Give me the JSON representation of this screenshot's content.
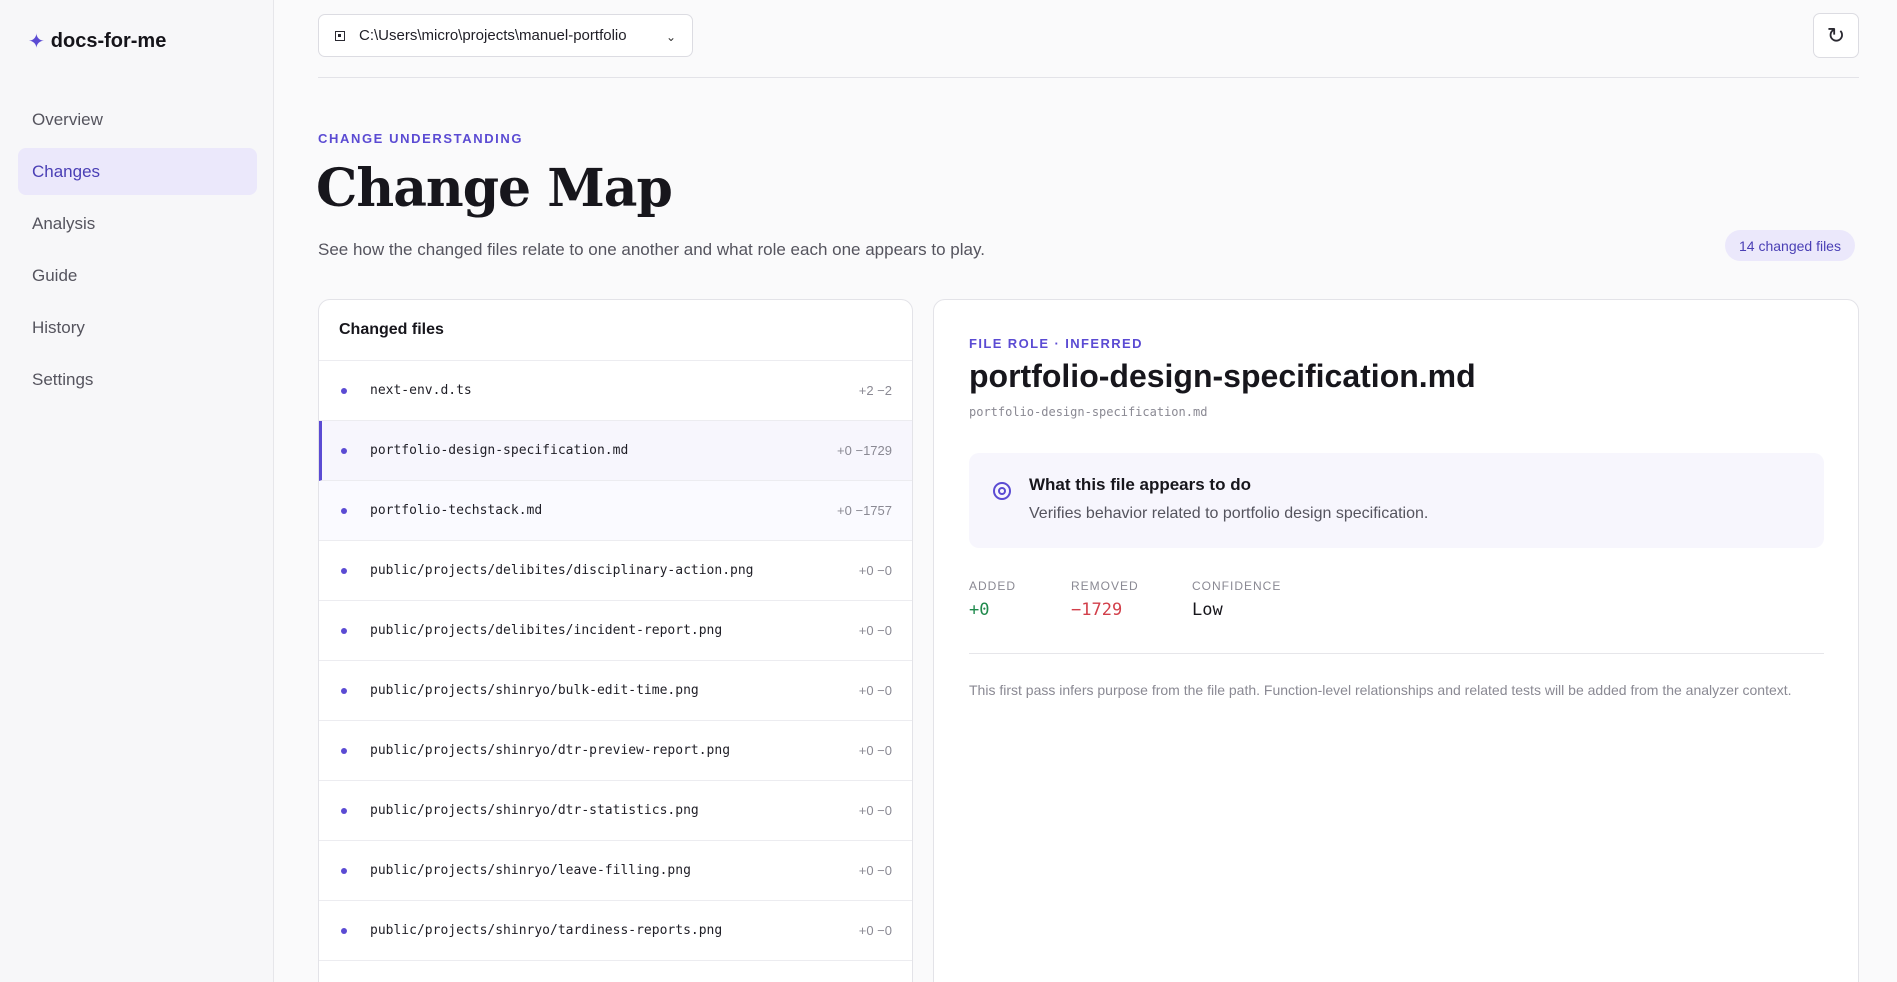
{
  "sidebar": {
    "brand_icon": "✦",
    "brand": "docs-for-me",
    "items": [
      {
        "label": "Overview"
      },
      {
        "label": "Changes"
      },
      {
        "label": "Analysis"
      },
      {
        "label": "Guide"
      },
      {
        "label": "History"
      },
      {
        "label": "Settings"
      }
    ],
    "active": "Changes"
  },
  "topbar": {
    "path": "C:\\Users\\micro\\projects\\manuel-portfolio",
    "folder_icon": "folder-icon",
    "chevron": "⌄",
    "refresh_icon": "↻"
  },
  "header": {
    "eyebrow": "CHANGE UNDERSTANDING",
    "title": "Change Map",
    "subtitle": "See how the changed files relate to one another and what role each one appears to play.",
    "badge": "14 changed files"
  },
  "files": {
    "heading": "Changed files",
    "rows": [
      {
        "name": "next-env.d.ts",
        "stat": "+2 −2"
      },
      {
        "name": "portfolio-design-specification.md",
        "stat": "+0 −1729"
      },
      {
        "name": "portfolio-techstack.md",
        "stat": "+0 −1757"
      },
      {
        "name": "public/projects/delibites/disciplinary-action.png",
        "stat": "+0 −0"
      },
      {
        "name": "public/projects/delibites/incident-report.png",
        "stat": "+0 −0"
      },
      {
        "name": "public/projects/shinryo/bulk-edit-time.png",
        "stat": "+0 −0"
      },
      {
        "name": "public/projects/shinryo/dtr-preview-report.png",
        "stat": "+0 −0"
      },
      {
        "name": "public/projects/shinryo/dtr-statistics.png",
        "stat": "+0 −0"
      },
      {
        "name": "public/projects/shinryo/leave-filling.png",
        "stat": "+0 −0"
      },
      {
        "name": "public/projects/shinryo/tardiness-reports.png",
        "stat": "+0 −0"
      }
    ],
    "selected": "portfolio-design-specification.md"
  },
  "detail": {
    "eyebrow": "FILE ROLE · INFERRED",
    "title": "portfolio-design-specification.md",
    "path": "portfolio-design-specification.md",
    "purpose_title": "What this file appears to do",
    "purpose_text": "Verifies behavior related to portfolio design specification.",
    "stats": {
      "added_label": "ADDED",
      "added": "+0",
      "removed_label": "REMOVED",
      "removed": "−1729",
      "confidence_label": "CONFIDENCE",
      "confidence": "Low"
    },
    "note": "This first pass infers purpose from the file path. Function-level relationships and related tests will be added from the analyzer context."
  },
  "colors": {
    "accent": "#5b4bd3",
    "added": "#1f8a4c",
    "removed": "#d23f4a"
  }
}
